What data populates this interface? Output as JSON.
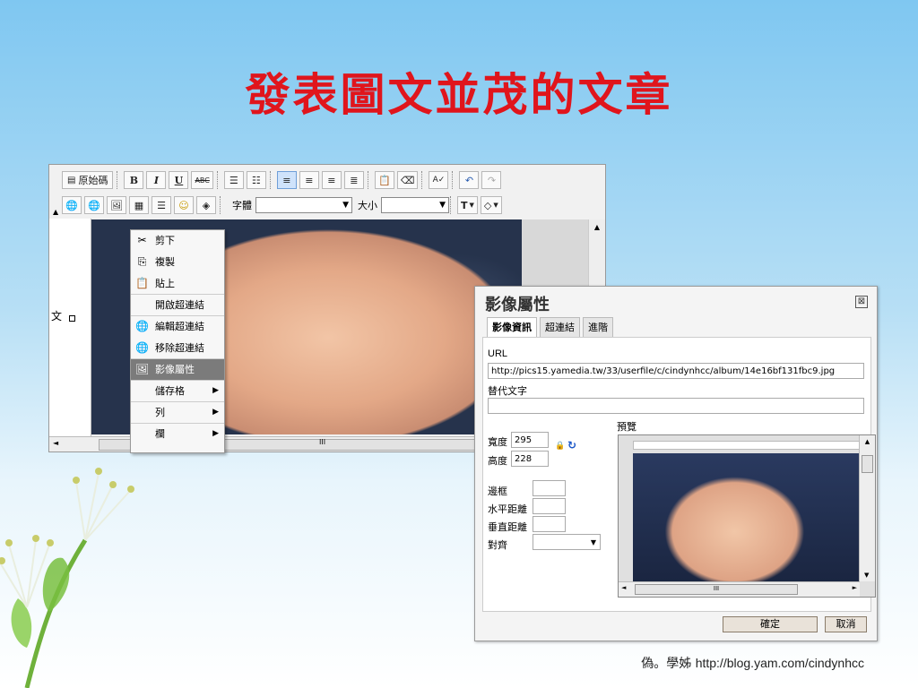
{
  "slide": {
    "title": "發表圖文並茂的文章",
    "footer_author": "偽。學姊",
    "footer_url": "http://blog.yam.com/cindynhcc"
  },
  "editor": {
    "toolbar": {
      "source_label": "原始碼",
      "bold": "B",
      "italic": "I",
      "underline": "U",
      "strike": "ABC",
      "font_label": "字體",
      "size_label": "大小",
      "text_color": "T",
      "font_value": "",
      "size_value": ""
    },
    "side_char": "文",
    "scroll_mark": "III"
  },
  "context_menu": {
    "items": [
      {
        "label": "剪下",
        "icon": "scissors-icon"
      },
      {
        "label": "複製",
        "icon": "copy-icon"
      },
      {
        "label": "貼上",
        "icon": "paste-icon"
      },
      {
        "label": "開啟超連結",
        "icon": ""
      },
      {
        "label": "編輯超連結",
        "icon": "globe-link-icon"
      },
      {
        "label": "移除超連結",
        "icon": "globe-unlink-icon"
      },
      {
        "label": "影像屬性",
        "icon": "image-icon",
        "selected": true
      },
      {
        "label": "儲存格",
        "submenu": true
      },
      {
        "label": "列",
        "submenu": true
      },
      {
        "label": "欄",
        "submenu": true
      }
    ]
  },
  "dialog": {
    "title": "影像屬性",
    "close_glyph": "⊠",
    "tabs": [
      "影像資訊",
      "超連結",
      "進階"
    ],
    "url_label": "URL",
    "url_value": "http://pics15.yamedia.tw/33/userfile/c/cindynhcc/album/14e16bf131fbc9.jpg",
    "alt_label": "替代文字",
    "alt_value": "",
    "preview_label": "預覽",
    "width_label": "寬度",
    "width_value": "295",
    "height_label": "高度",
    "height_value": "228",
    "border_label": "邊框",
    "hspace_label": "水平距離",
    "vspace_label": "垂直距離",
    "align_label": "對齊",
    "preview_scroll_mark": "III",
    "ok_label": "確定",
    "cancel_label": "取消"
  }
}
